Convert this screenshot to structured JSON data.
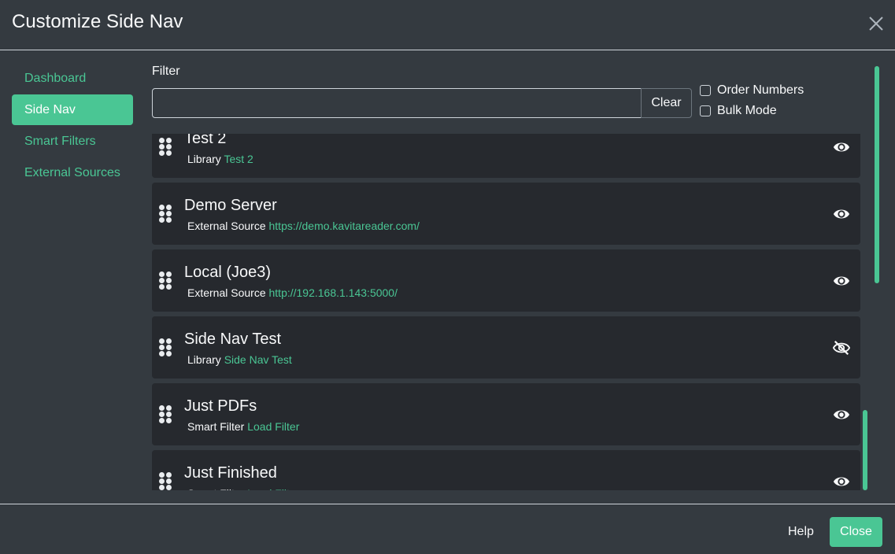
{
  "header": {
    "title": "Customize Side Nav",
    "close_icon": "close-icon"
  },
  "sidenav": {
    "items": [
      {
        "label": "Dashboard",
        "active": false
      },
      {
        "label": "Side Nav",
        "active": true
      },
      {
        "label": "Smart Filters",
        "active": false
      },
      {
        "label": "External Sources",
        "active": false
      }
    ]
  },
  "filter": {
    "label": "Filter",
    "value": "",
    "placeholder": "",
    "clear_label": "Clear"
  },
  "options": {
    "order_numbers": "Order Numbers",
    "bulk_mode": "Bulk Mode"
  },
  "items": [
    {
      "title": "Test 2",
      "type": "Library",
      "link": "Test 2",
      "visible": true
    },
    {
      "title": "Demo Server",
      "type": "External Source",
      "link": "https://demo.kavitareader.com/",
      "visible": true
    },
    {
      "title": "Local (Joe3)",
      "type": "External Source",
      "link": "http://192.168.1.143:5000/",
      "visible": true
    },
    {
      "title": "Side Nav Test",
      "type": "Library",
      "link": "Side Nav Test",
      "visible": false
    },
    {
      "title": "Just PDFs",
      "type": "Smart Filter",
      "link": "Load Filter",
      "visible": true
    },
    {
      "title": "Just Finished",
      "type": "Smart Filter",
      "link": "Load Filter",
      "visible": true
    }
  ],
  "footer": {
    "help_label": "Help",
    "close_label": "Close"
  },
  "colors": {
    "accent": "#4ac694",
    "background": "#343a40",
    "card": "#26292e"
  }
}
